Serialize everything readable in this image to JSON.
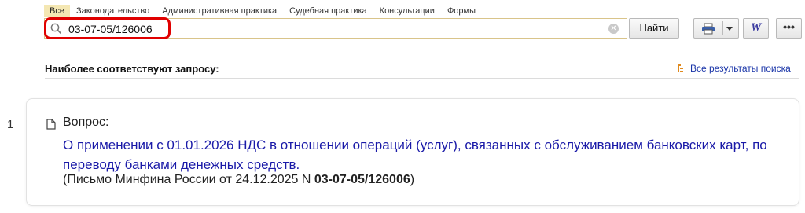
{
  "tabs": [
    {
      "label": "Все",
      "active": true
    },
    {
      "label": "Законодательство"
    },
    {
      "label": "Административная практика"
    },
    {
      "label": "Судебная практика"
    },
    {
      "label": "Консультации"
    },
    {
      "label": "Формы"
    }
  ],
  "search": {
    "value": "03-07-05/126006",
    "clear_glyph": "✕"
  },
  "toolbar": {
    "find_label": "Найти",
    "word_glyph": "W",
    "more_glyph": "•••"
  },
  "section": {
    "title": "Наиболее соответствуют запросу:",
    "all_results": "Все результаты поиска"
  },
  "result": {
    "number": "1",
    "label": "Вопрос:",
    "title": "О применении с 01.01.2026 НДС в отношении операций (услуг), связанных с обслуживанием банковских карт, по переводу банками денежных средств.",
    "source_prefix": "(Письмо Минфина России от 24.12.2025 N ",
    "source_number": "03-07-05/126006",
    "source_suffix": ")"
  },
  "colors": {
    "highlight": "#e00000",
    "link": "#1a1aa8",
    "active_tab": "#f4e7b3"
  }
}
